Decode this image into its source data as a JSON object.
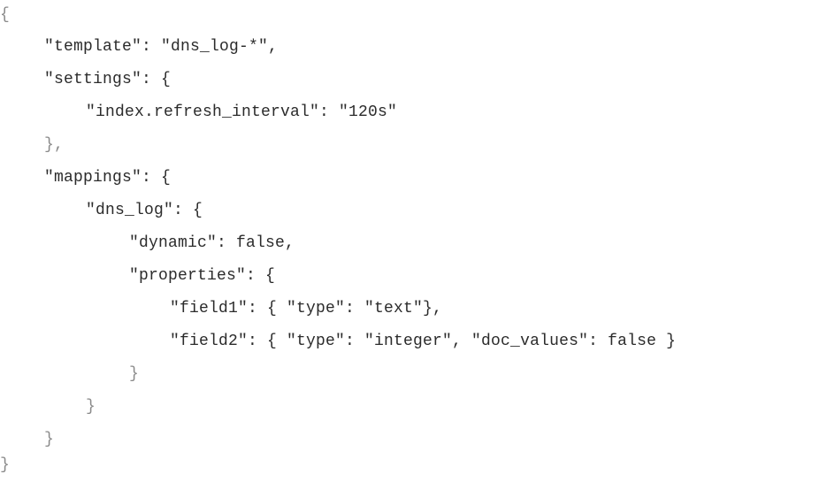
{
  "document": {
    "lines": [
      "{",
      "\"template\": \"dns_log-*\",",
      "\"settings\": {",
      "\"index.refresh_interval\": \"120s\"",
      "},",
      "\"mappings\": {",
      "\"dns_log\": {",
      "\"dynamic\": false,",
      "\"properties\": {",
      "\"field1\": { \"type\": \"text\"},",
      "\"field2\": { \"type\": \"integer\", \"doc_values\": false }",
      "}",
      "}",
      "}",
      "}"
    ]
  }
}
